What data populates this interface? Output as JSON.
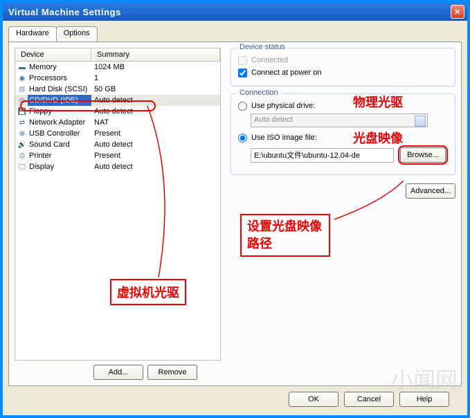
{
  "window": {
    "title": "Virtual Machine Settings"
  },
  "tabs": {
    "hardware": "Hardware",
    "options": "Options"
  },
  "columns": {
    "device": "Device",
    "summary": "Summary"
  },
  "devices": [
    {
      "icon": "memory-icon",
      "glyph": "▬",
      "name": "Memory",
      "summary": "1024 MB"
    },
    {
      "icon": "cpu-icon",
      "glyph": "◉",
      "name": "Processors",
      "summary": "1"
    },
    {
      "icon": "disk-icon",
      "glyph": "⊟",
      "name": "Hard Disk (SCSI)",
      "summary": "50 GB"
    },
    {
      "icon": "cd-icon",
      "glyph": "◎",
      "name": "CD/DVD (IDE)",
      "summary": "Auto detect"
    },
    {
      "icon": "floppy-icon",
      "glyph": "💾",
      "name": "Floppy",
      "summary": "Auto detect"
    },
    {
      "icon": "network-icon",
      "glyph": "⇄",
      "name": "Network Adapter",
      "summary": "NAT"
    },
    {
      "icon": "usb-icon",
      "glyph": "⊕",
      "name": "USB Controller",
      "summary": "Present"
    },
    {
      "icon": "sound-icon",
      "glyph": "🔊",
      "name": "Sound Card",
      "summary": "Auto detect"
    },
    {
      "icon": "printer-icon",
      "glyph": "⎙",
      "name": "Printer",
      "summary": "Present"
    },
    {
      "icon": "display-icon",
      "glyph": "🖵",
      "name": "Display",
      "summary": "Auto detect"
    }
  ],
  "buttons": {
    "add": "Add...",
    "remove": "Remove",
    "browse": "Browse...",
    "advanced": "Advanced...",
    "ok": "OK",
    "cancel": "Cancel",
    "help": "Help"
  },
  "status": {
    "legend": "Device status",
    "connected": "Connected",
    "poweron": "Connect at power on",
    "connected_checked": false,
    "poweron_checked": true
  },
  "connection": {
    "legend": "Connection",
    "physical": "Use physical drive:",
    "physical_value": "Auto detect",
    "iso": "Use ISO image file:",
    "iso_value": "E:\\ubuntu文件\\ubuntu-12.04-de",
    "selected": "iso"
  },
  "annotations": {
    "vmdrive": "虚拟机光驱",
    "physical": "物理光驱",
    "iso": "光盘映像",
    "setpath": "设置光盘映像路径"
  },
  "watermark": "小闻网"
}
